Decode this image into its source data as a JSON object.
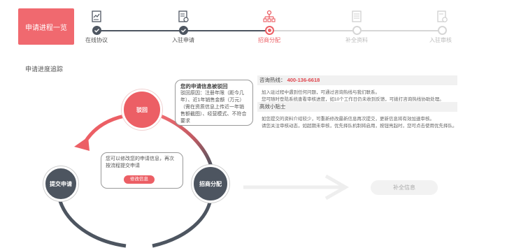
{
  "header": {
    "badge": "申请进程一览"
  },
  "steps": [
    {
      "label": "在线协议",
      "state": "done",
      "icon": "document-sign-icon"
    },
    {
      "label": "入驻申请",
      "state": "done",
      "icon": "document-edit-icon"
    },
    {
      "label": "招商分配",
      "state": "current",
      "icon": "org-chart-icon"
    },
    {
      "label": "补全资料",
      "state": "pending",
      "icon": "document-list-icon"
    },
    {
      "label": "入驻审核",
      "state": "pending",
      "icon": "document-settings-icon"
    }
  ],
  "section": {
    "title": "申请进度追踪"
  },
  "info": {
    "hotline_label": "咨询热线：",
    "hotline_number": "400-136-6618",
    "line1": "加入驻过程中遇到任何问题，可通过咨询热线与我们联系。",
    "line2": "您可随时登陆系统查看审核进度，如10个工作日仍未收到反馈，可拨打咨询热线协助处理。",
    "tips_title": "高效小贴士",
    "tip1": "如您提交的资料介绍较少，可重新修改最新信息再次提交，更新信息将有效加速审核。",
    "tip2": "请您关注审核动态，如超期未审核，优先择队机制将启用，按钮亮起时，您可点击使用优先择队。"
  },
  "flow": {
    "node_reject": "驳回",
    "node_submit": "提交申请",
    "node_assign": "招商分配",
    "reject_bubble": {
      "title": "您的申请信息被驳回",
      "body": "驳回原因：注册年限（距今几年）、近1年销售金额（万元）（需在资质信息上传近一年销售额截图）、经营模式、不符合要求"
    },
    "modify_bubble": {
      "body": "您可以修改您的申请信息，再次按流程提交申请",
      "button": "修改信息"
    },
    "complete_button": "补全信息"
  },
  "colors": {
    "accent": "#ec5f65",
    "dark": "#4d5560",
    "muted": "#cccccc"
  }
}
